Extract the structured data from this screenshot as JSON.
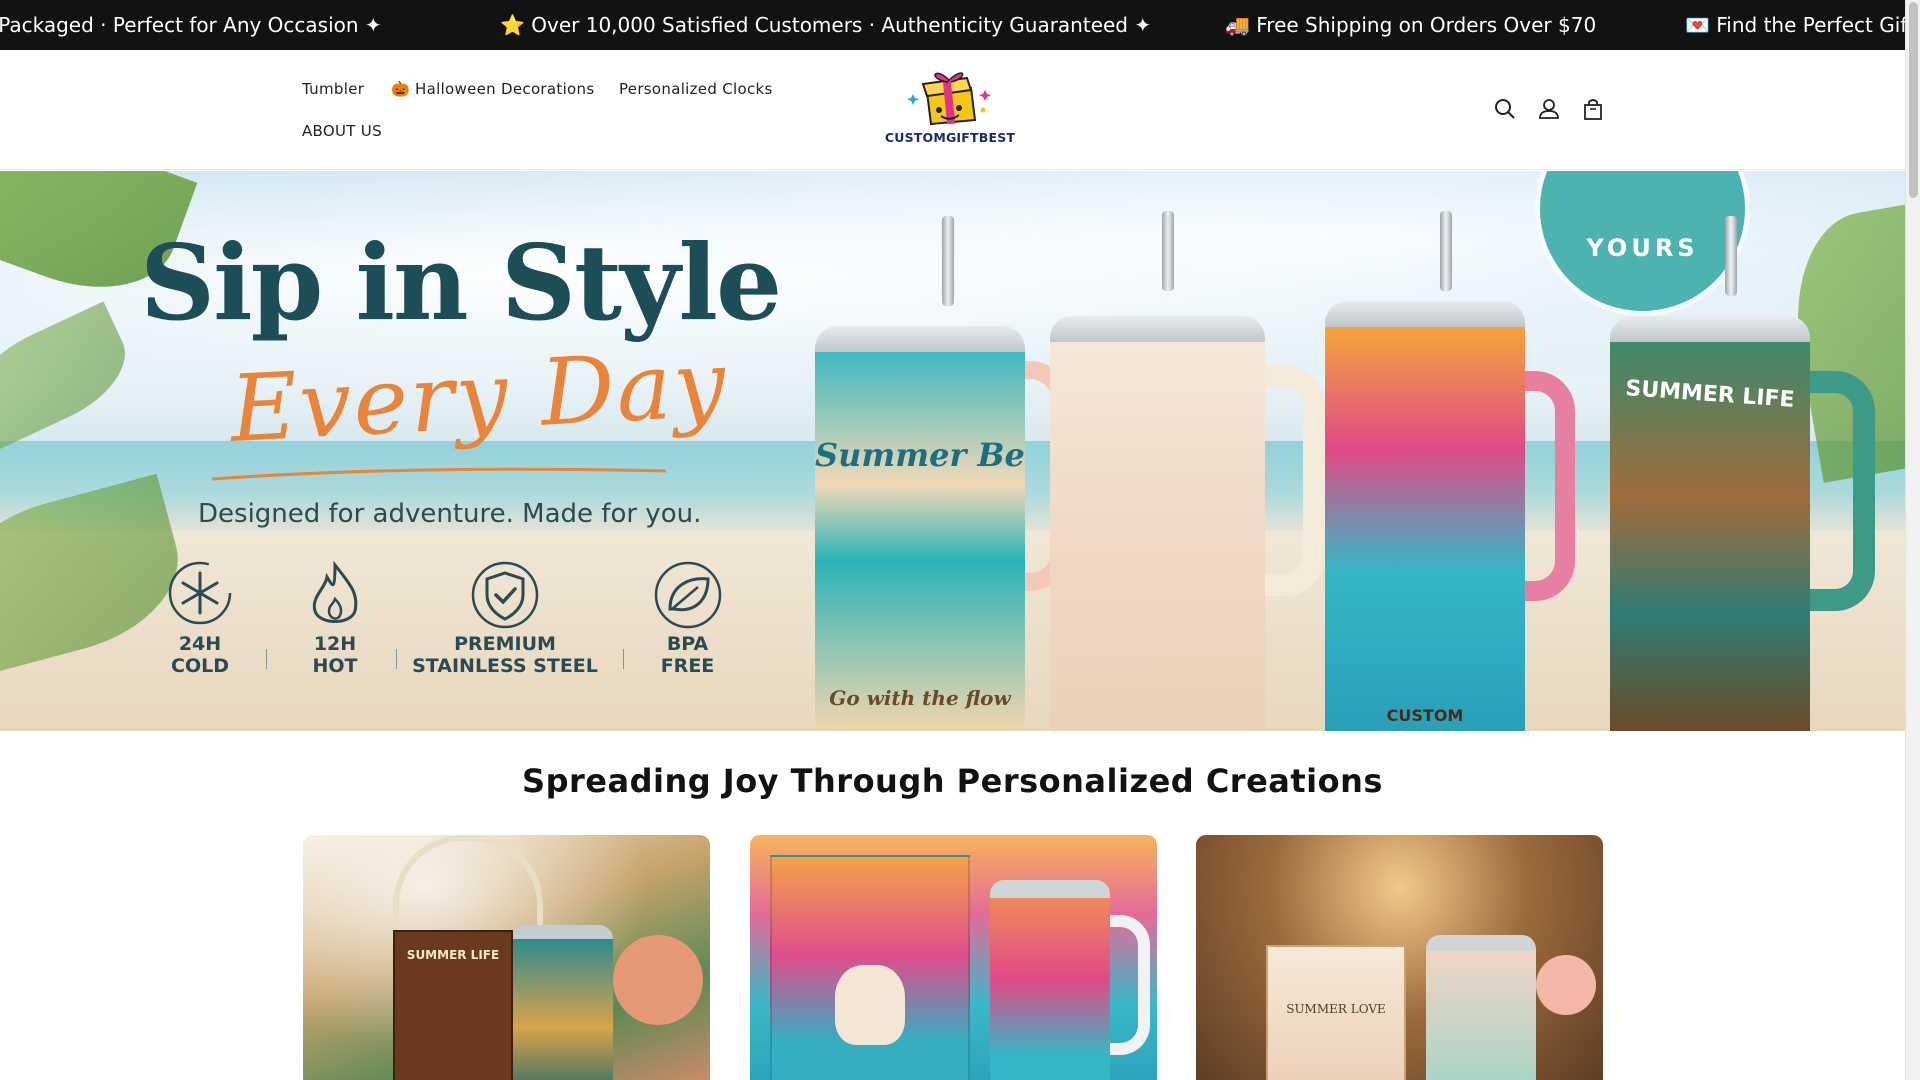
{
  "announcement": {
    "items": [
      "y Packaged · Perfect for Any Occasion ✦",
      "⭐ Over 10,000 Satisfied Customers · Authenticity Guaranteed ✦",
      "🚚 Free Shipping on Orders Over $70",
      "💌 Find the Perfect Gift"
    ]
  },
  "nav": {
    "links": [
      "Tumbler",
      "🎃 Halloween Decorations",
      "Personalized Clocks",
      "ABOUT US"
    ]
  },
  "logo": {
    "text": "CUSTOMGIFTBEST",
    "icon": "gift-box-icon"
  },
  "header_icons": [
    "search-icon",
    "account-icon",
    "cart-icon"
  ],
  "hero": {
    "title": "Sip in Style",
    "script": "Every Day",
    "subtitle": "Designed for adventure. Made for you.",
    "features": [
      {
        "icon": "snowflake-icon",
        "label": "24H\nCOLD"
      },
      {
        "icon": "flame-icon",
        "label": "12H\nHOT"
      },
      {
        "icon": "shield-check-icon",
        "label": "PREMIUM\nSTAINLESS STEEL"
      },
      {
        "icon": "leaf-icon",
        "label": "BPA\nFREE"
      }
    ],
    "badge_text": "YOURS",
    "tumbler_texts": [
      "Summer Beach",
      "SUMMER LIFE",
      "Go with the flow",
      "CUSTOM"
    ],
    "colors": {
      "title": "#1d4d57",
      "script": "#e8853a",
      "badge": "#4db3b1"
    }
  },
  "section": {
    "title": "Spreading Joy Through Personalized Creations"
  },
  "cards": [
    {
      "name": "summer-life-parrot-tumbler-card",
      "box_text": "SUMMER LIFE"
    },
    {
      "name": "sugar-skull-tumbler-card"
    },
    {
      "name": "summer-love-flamingo-tumbler-card",
      "box_text": "SUMMER LOVE"
    }
  ]
}
